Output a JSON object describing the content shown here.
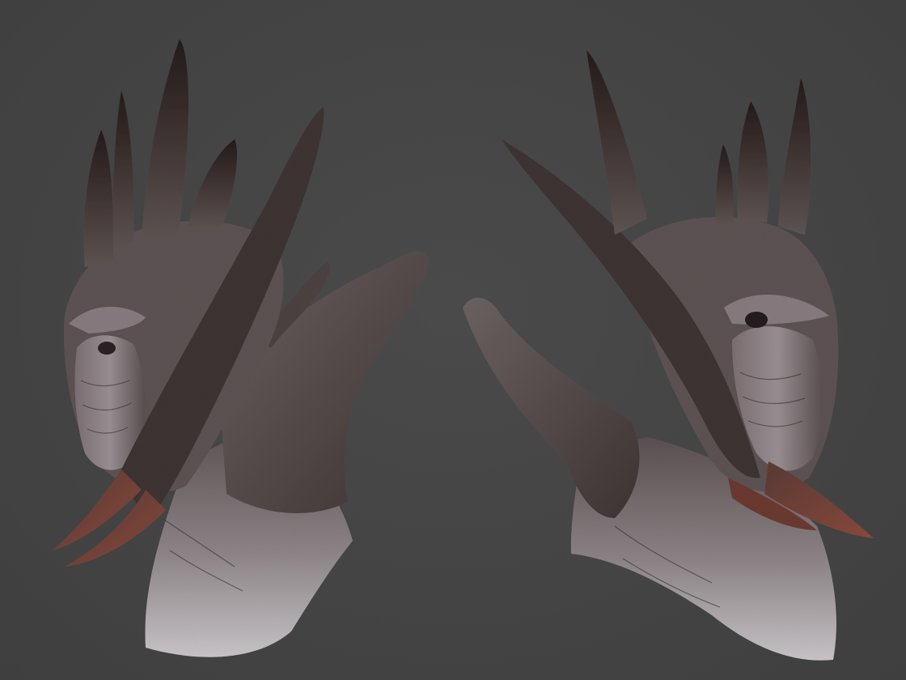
{
  "scene": {
    "background_color": "#464646",
    "subject": "sculpted-creature-bust",
    "views": [
      {
        "id": "left-view",
        "facing": "left"
      },
      {
        "id": "right-view",
        "facing": "right"
      }
    ],
    "colors": {
      "skin_dark": "#3a2f2e",
      "skin_mid": "#6a5f5e",
      "skin_light": "#b3aeb1",
      "horn_tip": "#2b2220",
      "tusk_red": "#7a3d33"
    }
  }
}
